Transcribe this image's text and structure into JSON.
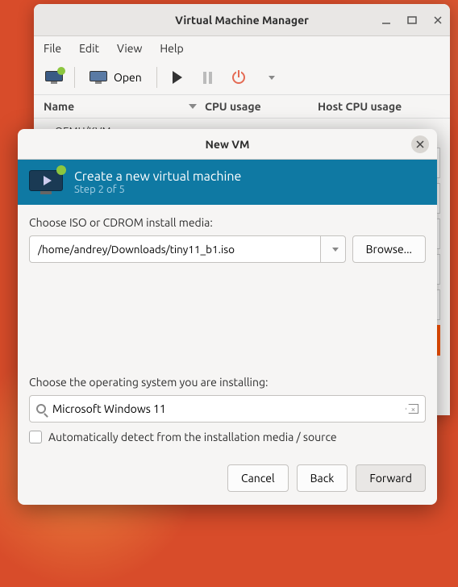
{
  "main_window": {
    "title": "Virtual Machine Manager",
    "menubar": {
      "file": "File",
      "edit": "Edit",
      "view": "View",
      "help": "Help"
    },
    "toolbar": {
      "open_label": "Open"
    },
    "columns": {
      "name": "Name",
      "cpu": "CPU usage",
      "host_cpu": "Host CPU usage"
    },
    "hypervisor_row": "QEMU/KVM"
  },
  "dialog": {
    "title": "New VM",
    "banner_title": "Create a new virtual machine",
    "banner_step": "Step 2 of 5",
    "iso_label": "Choose ISO or CDROM install media:",
    "iso_value": "/home/andrey/Downloads/tiny11_b1.iso",
    "browse_label": "Browse...",
    "os_label": "Choose the operating system you are installing:",
    "os_value": "Microsoft Windows 11",
    "autodetect_label": "Automatically detect from the installation media / source",
    "buttons": {
      "cancel": "Cancel",
      "back": "Back",
      "forward": "Forward"
    }
  }
}
